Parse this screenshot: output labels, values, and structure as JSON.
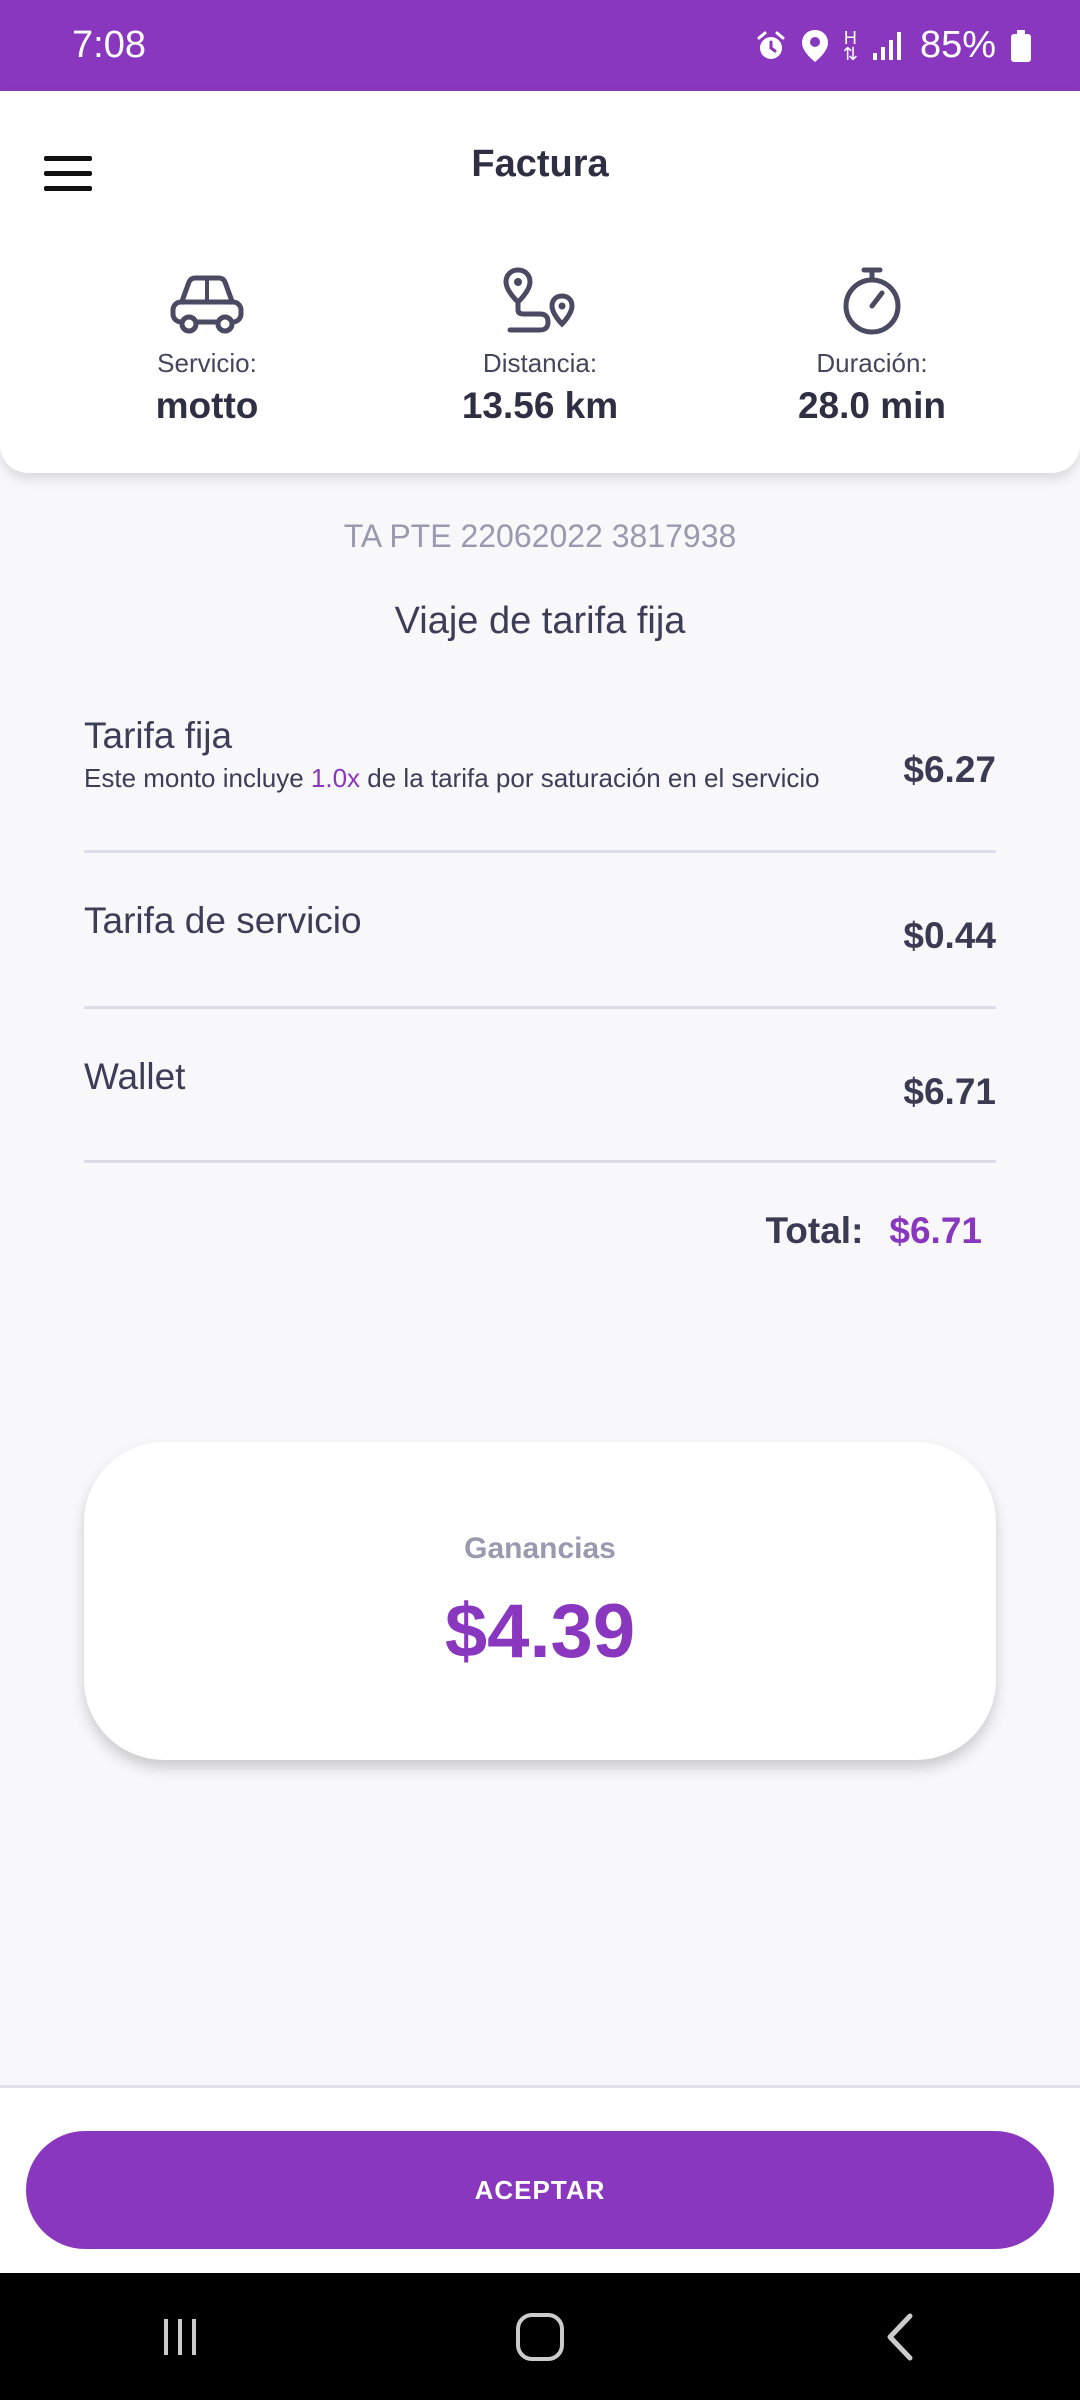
{
  "status_bar": {
    "time": "7:08",
    "network": "H",
    "battery": "85%"
  },
  "header": {
    "title": "Factura"
  },
  "stats": {
    "service": {
      "label": "Servicio:",
      "value": "motto",
      "icon": "car-icon"
    },
    "distance": {
      "label": "Distancia:",
      "value": "13.56 km",
      "icon": "route-icon"
    },
    "duration": {
      "label": "Duración:",
      "value": "28.0 min",
      "icon": "stopwatch-icon"
    }
  },
  "trip": {
    "reference": "TA PTE 22062022 3817938",
    "type": "Viaje de tarifa fija"
  },
  "items": [
    {
      "name": "Tarifa fija",
      "note_before": "Este monto incluye ",
      "note_highlight": "1.0x",
      "note_after": " de la tarifa por saturación en el servicio",
      "amount": "$6.27"
    },
    {
      "name": "Tarifa de servicio",
      "amount": "$0.44"
    },
    {
      "name": "Wallet",
      "amount": "$6.71"
    }
  ],
  "total": {
    "label": "Total:",
    "value": "$6.71"
  },
  "earnings": {
    "label": "Ganancias",
    "value": "$4.39"
  },
  "actions": {
    "accept_label": "ACEPTAR"
  },
  "colors": {
    "accent": "#8a37bf",
    "text": "#3a3a52",
    "muted": "#9a99b0"
  }
}
